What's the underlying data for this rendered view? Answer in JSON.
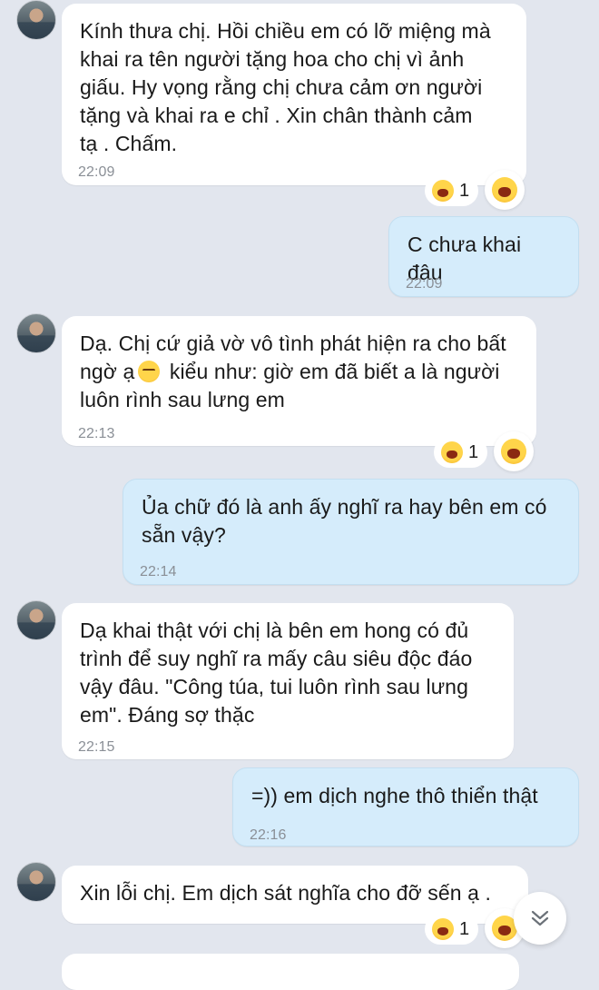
{
  "messages": [
    {
      "from": "them",
      "text": "Kính thưa chị. Hồi chiều em có lỡ miệng mà\nkhai ra tên người tặng hoa cho chị vì ảnh\ngiấu. Hy vọng rằng chị chưa cảm ơn người\ntặng và khai ra e chỉ . Xin chân thành cảm\ntạ . Chấm.",
      "time": "22:09",
      "reaction_count": "1"
    },
    {
      "from": "me",
      "text": "C chưa khai đâu",
      "time": "22:09"
    },
    {
      "from": "them",
      "text_part1": "Dạ. Chị cứ giả vờ vô tình phát hiện ra cho bất\nngờ ạ",
      "text_part2": " kiểu như: giờ em đã biết a là người\nluôn rình sau lưng em",
      "time": "22:13",
      "reaction_count": "1",
      "inline_emoji": "unamused-face"
    },
    {
      "from": "me",
      "text": "Ủa chữ đó là anh ấy nghĩ ra hay bên em có\nsẵn vậy?",
      "time": "22:14"
    },
    {
      "from": "them",
      "text": "Dạ khai thật với chị là bên em hong có đủ\ntrình để suy nghĩ ra mấy câu siêu độc đáo\nvậy đâu. \"Công túa, tui luôn rình sau lưng\nem\". Đáng sợ thặc",
      "time": "22:15"
    },
    {
      "from": "me",
      "text": "=)) em dịch nghe thô thiển thật",
      "time": "22:16"
    },
    {
      "from": "them",
      "text": "Xin lỗi chị. Em dịch sát nghĩa cho đỡ sến ạ .",
      "reaction_count": "1"
    }
  ],
  "reaction_emoji": "laughing-face",
  "scroll_icon": "double-chevron-down-icon",
  "colors": {
    "background": "#e2e6ee",
    "incoming": "#ffffff",
    "outgoing": "#d5ecfb",
    "timestamp": "#8a8f96"
  }
}
